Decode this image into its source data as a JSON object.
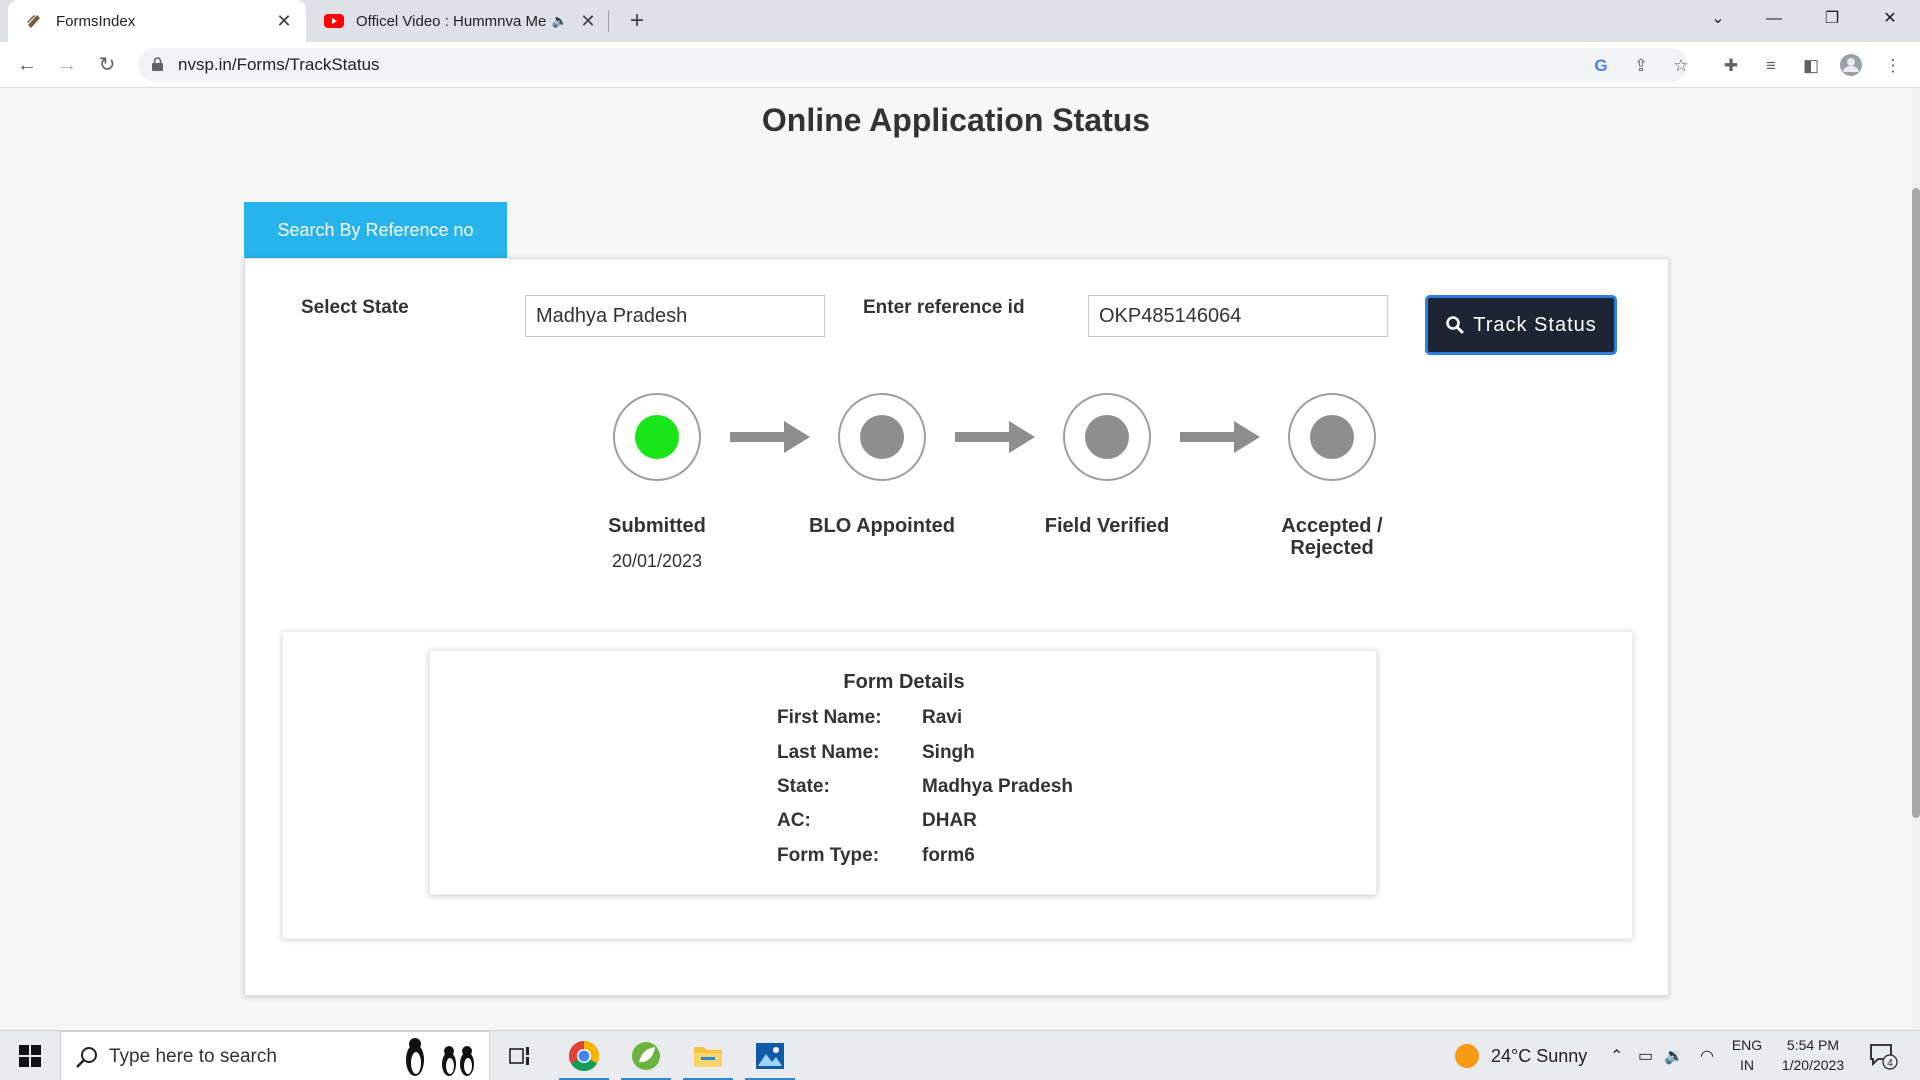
{
  "browser": {
    "tabs": [
      {
        "title": "FormsIndex",
        "active": true
      },
      {
        "title": "Officel Video : Hummnva Me",
        "active": false
      }
    ],
    "url": "nvsp.in/Forms/TrackStatus"
  },
  "page": {
    "title": "Online Application Status",
    "search_tab_label": "Search By Reference no",
    "state_label": "Select State",
    "state_value": "Madhya Pradesh",
    "reference_label": "Enter reference id",
    "reference_value": "OKP485146064",
    "track_button": "Track Status"
  },
  "progress": {
    "steps": [
      {
        "label": "Submitted",
        "date": "20/01/2023",
        "done": true
      },
      {
        "label": "BLO Appointed",
        "done": false
      },
      {
        "label": "Field Verified",
        "done": false
      },
      {
        "label_line1": "Accepted /",
        "label_line2": "Rejected",
        "done": false
      }
    ],
    "done_color": "#19e619",
    "pending_color": "#8e8e8e"
  },
  "form_details": {
    "title": "Form Details",
    "rows": [
      {
        "key": "First Name:",
        "value": "Ravi"
      },
      {
        "key": "Last Name:",
        "value": "Singh"
      },
      {
        "key": "State:",
        "value": "Madhya Pradesh"
      },
      {
        "key": "AC:",
        "value": "DHAR"
      },
      {
        "key": "Form Type:",
        "value": "form6"
      }
    ]
  },
  "taskbar": {
    "search_placeholder": "Type here to search",
    "weather": "24°C  Sunny",
    "lang_line1": "ENG",
    "lang_line2": "IN",
    "time": "5:54 PM",
    "date": "1/20/2023",
    "notifications": "4"
  },
  "colors": {
    "accent_tab": "#27b3ec",
    "track_button_bg": "#1b2533",
    "track_button_border": "#2e7ee0"
  }
}
